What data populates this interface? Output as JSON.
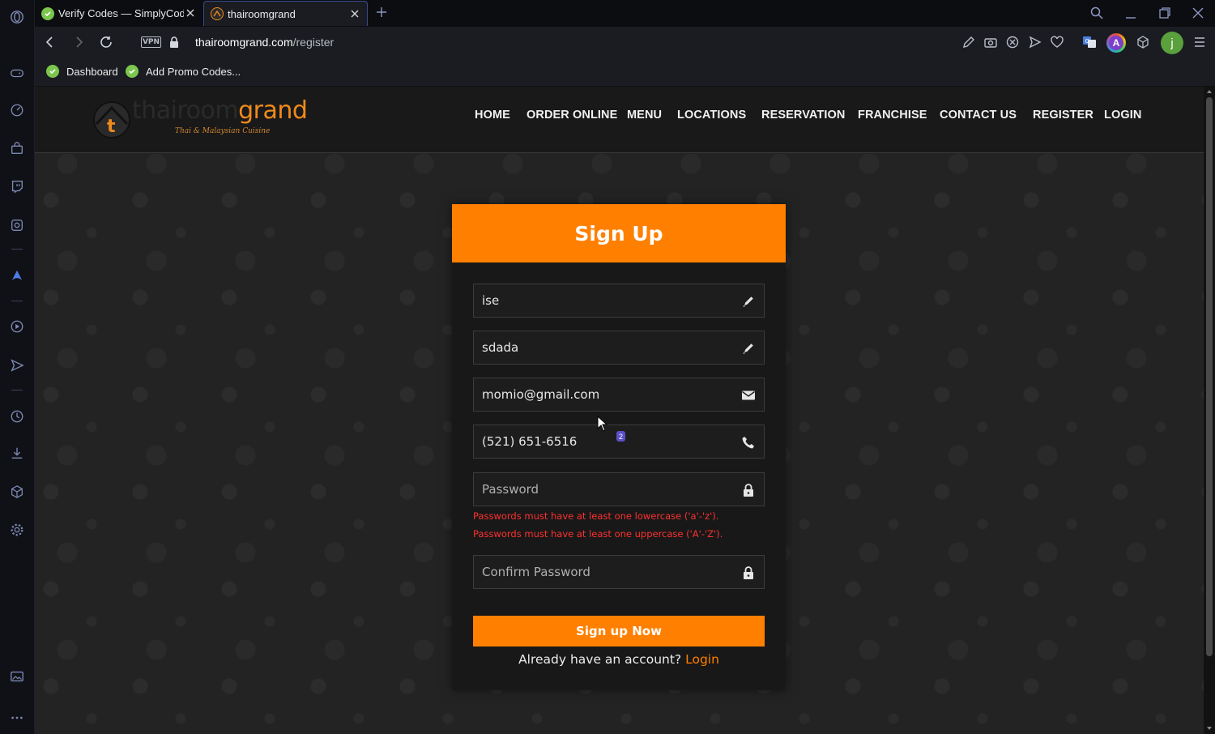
{
  "browser": {
    "tabs": [
      {
        "title": "Verify Codes — SimplyCodes",
        "active": false
      },
      {
        "title": "thairoomgrand",
        "active": true
      }
    ],
    "address": {
      "vpn_label": "VPN",
      "host": "thairoomgrand.com",
      "path": "/register"
    },
    "bookmarks": [
      {
        "label": "Dashboard"
      },
      {
        "label": "Add Promo Codes..."
      }
    ],
    "profile_initial": "j",
    "extension_initial": "A"
  },
  "site": {
    "logo_part1": "thairoom",
    "logo_part2": "grand",
    "logo_mark": "t",
    "tagline": "Thai & Malaysian Cuisine",
    "nav": [
      "HOME",
      "ORDER ONLINE",
      "MENU",
      "LOCATIONS",
      "RESERVATION",
      "FRANCHISE",
      "CONTACT US",
      "REGISTER",
      "LOGIN"
    ]
  },
  "form": {
    "title": "Sign Up",
    "first_name": {
      "value": "ise",
      "icon": "pencil-icon"
    },
    "last_name": {
      "value": "sdada",
      "icon": "pencil-icon"
    },
    "email": {
      "value": "momio@gmail.com",
      "icon": "envelope-icon"
    },
    "phone": {
      "value": "(521) 651-6516",
      "icon": "phone-icon"
    },
    "password": {
      "value": "",
      "placeholder": "Password",
      "icon": "lock-icon"
    },
    "password_errors": [
      "Passwords must have at least one lowercase ('a'-'z').",
      "Passwords must have at least one uppercase ('A'-'Z')."
    ],
    "confirm_password": {
      "value": "",
      "placeholder": "Confirm Password",
      "icon": "lock-icon"
    },
    "overlay_badge": "2",
    "submit_label": "Sign up Now",
    "already_text": "Already have an account?",
    "login_link": "Login"
  },
  "colors": {
    "accent": "#ff7f00",
    "error": "#ff3030",
    "page_bg": "#232323",
    "card_bg": "#181818"
  }
}
